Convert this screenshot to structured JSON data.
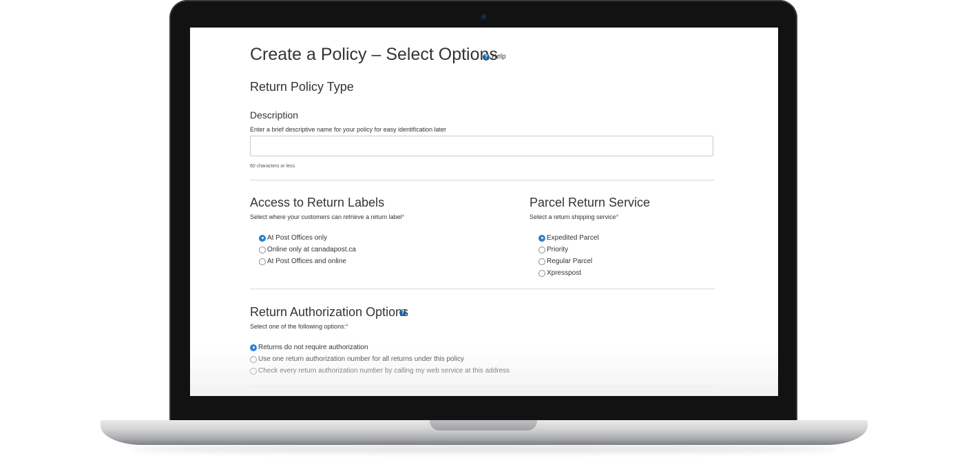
{
  "page": {
    "title": "Create a Policy – Select Options",
    "help_label": "Help"
  },
  "return_policy_type": {
    "heading": "Return Policy Type"
  },
  "description": {
    "label": "Description",
    "hint": "Enter a brief descriptive name for your policy for easy identification later",
    "value": "",
    "limit_note": "60 characters or less"
  },
  "access_to_return_labels": {
    "heading": "Access to Return Labels",
    "instruction": "Select where your customers can retrieve a return label",
    "required_mark": "*",
    "options": [
      {
        "label": "At Post Offices only",
        "checked": true
      },
      {
        "label": "Online only at canadapost.ca",
        "checked": false
      },
      {
        "label": "At Post Offices and online",
        "checked": false
      }
    ]
  },
  "parcel_return_service": {
    "heading": "Parcel Return Service",
    "instruction": "Select a return shipping service",
    "required_mark": "*",
    "options": [
      {
        "label": "Expedited Parcel",
        "checked": true
      },
      {
        "label": "Priority",
        "checked": false
      },
      {
        "label": "Regular Parcel",
        "checked": false
      },
      {
        "label": "Xpresspost",
        "checked": false
      }
    ]
  },
  "return_authorization": {
    "heading": "Return Authorization Options",
    "instruction": "Select one of the following options:",
    "required_mark": "*",
    "options": [
      {
        "label": "Returns do not require authorization",
        "checked": true
      },
      {
        "label": "Use one return authorization number for all returns under this policy",
        "checked": false
      },
      {
        "label": "Check every return authorization number by calling my web service at this address",
        "checked": false
      }
    ]
  },
  "icons": {
    "help": "help-circle-icon",
    "info": "info-circle-icon",
    "camera": "camera-icon"
  },
  "colors": {
    "accent_blue": "#2a7fd4",
    "help_blue": "#1f5e9c",
    "required_red": "#d33333",
    "bezel": "#121212"
  }
}
